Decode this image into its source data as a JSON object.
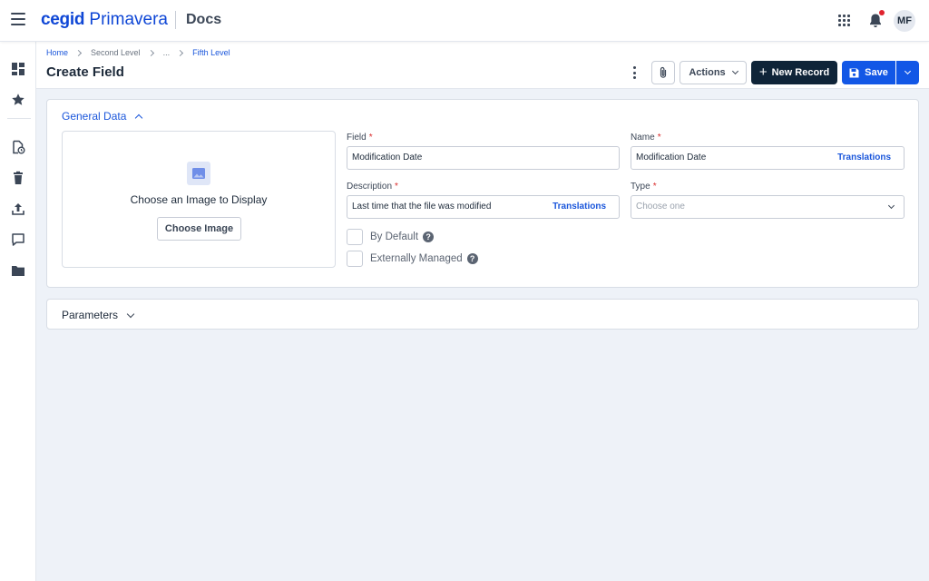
{
  "topbar": {
    "brand_bold": "cegid",
    "brand_light": "Primavera",
    "app_name": "Docs",
    "user_initials": "MF"
  },
  "sidebar": {
    "items": [
      {
        "icon": "dashboard-icon"
      },
      {
        "icon": "star-icon"
      },
      {
        "icon": "document-history-icon"
      },
      {
        "icon": "trash-icon"
      },
      {
        "icon": "upload-icon"
      },
      {
        "icon": "comment-icon"
      },
      {
        "icon": "folder-icon"
      }
    ]
  },
  "breadcrumb": {
    "items": [
      "Home",
      "Second Level",
      "...",
      "Fifth Level"
    ]
  },
  "page": {
    "title": "Create Field"
  },
  "toolbar": {
    "actions_label": "Actions",
    "new_record_label": "New Record",
    "save_label": "Save"
  },
  "general": {
    "section_title": "General Data",
    "image_prompt": "Choose an Image to Display",
    "choose_image_label": "Choose Image",
    "field": {
      "label": "Field",
      "value": "Modification Date"
    },
    "name": {
      "label": "Name",
      "value": "Modification Date",
      "translations": "Translations"
    },
    "description": {
      "label": "Description",
      "value": "Last time that the file was modified",
      "translations": "Translations"
    },
    "type": {
      "label": "Type",
      "placeholder": "Choose one"
    },
    "by_default": {
      "label": "By Default",
      "checked": false
    },
    "externally_managed": {
      "label": "Externally Managed",
      "checked": false
    }
  },
  "parameters": {
    "section_title": "Parameters"
  },
  "colors": {
    "brand": "#0f47d6",
    "primary": "#1257e6",
    "dark_button": "#0f2438",
    "link": "#1a56db",
    "required": "#d92b2b",
    "notification_dot": "#e0232e",
    "background": "#eef2f8"
  }
}
